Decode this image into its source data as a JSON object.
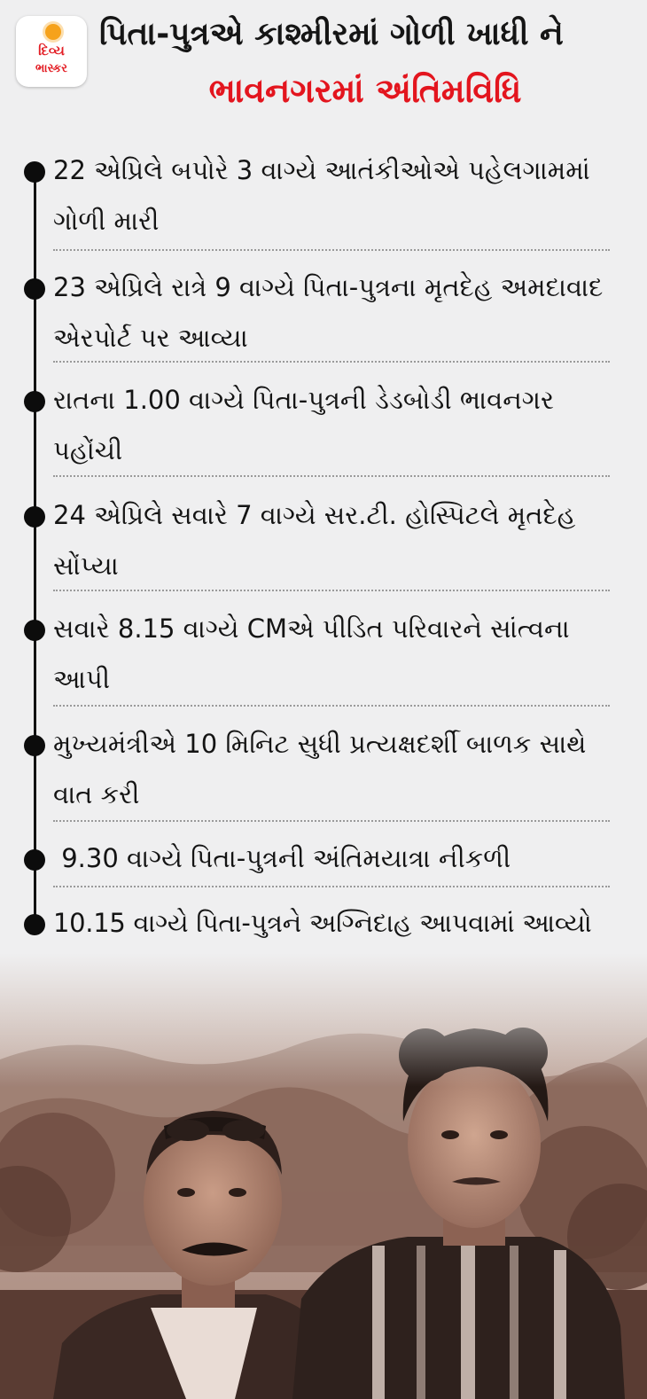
{
  "logo": {
    "line1": "દિવ્ય",
    "line2": "ભાસ્કર"
  },
  "title": {
    "line1": "પિતા-પુત્રએ કાશ્મીરમાં ગોળી ખાધી ને",
    "line2": "ભાવનગરમાં અંતિમવિધિ"
  },
  "timeline": [
    "22 એપ્રિલે બપોરે 3 વાગ્યે આતંકીઓએ પહેલગામમાં ગોળી મારી",
    "23 એપ્રિલે રાત્રે 9 વાગ્યે પિતા-પુત્રના મૃતદેહ અમદાવાદ એરપોર્ટ પર આવ્યા",
    "રાતના 1.00 વાગ્યે પિતા-પુત્રની ડેડબોડી ભાવનગર પહોંચી",
    "24 એપ્રિલે સવારે 7 વાગ્યે સર.ટી. હોસ્પિટલે મૃતદેહ સોંપ્યા",
    "સવારે 8.15 વાગ્યે CMએ પીડિત પરિવારને સાંત્વના આપી",
    "મુખ્યમંત્રીએ 10 મિનિટ સુધી પ્રત્યક્ષદર્શી બાળક સાથે વાત કરી",
    " 9.30 વાગ્યે પિતા-પુત્રની અંતિમયાત્રા નીકળી",
    "10.15 વાગ્યે પિતા-પુત્રને અગ્નિદાહ આપવામાં આવ્યો"
  ],
  "colors": {
    "accent_red": "#e3151e",
    "background": "#efeff0",
    "sepia_photo": "#8a6a5e"
  }
}
